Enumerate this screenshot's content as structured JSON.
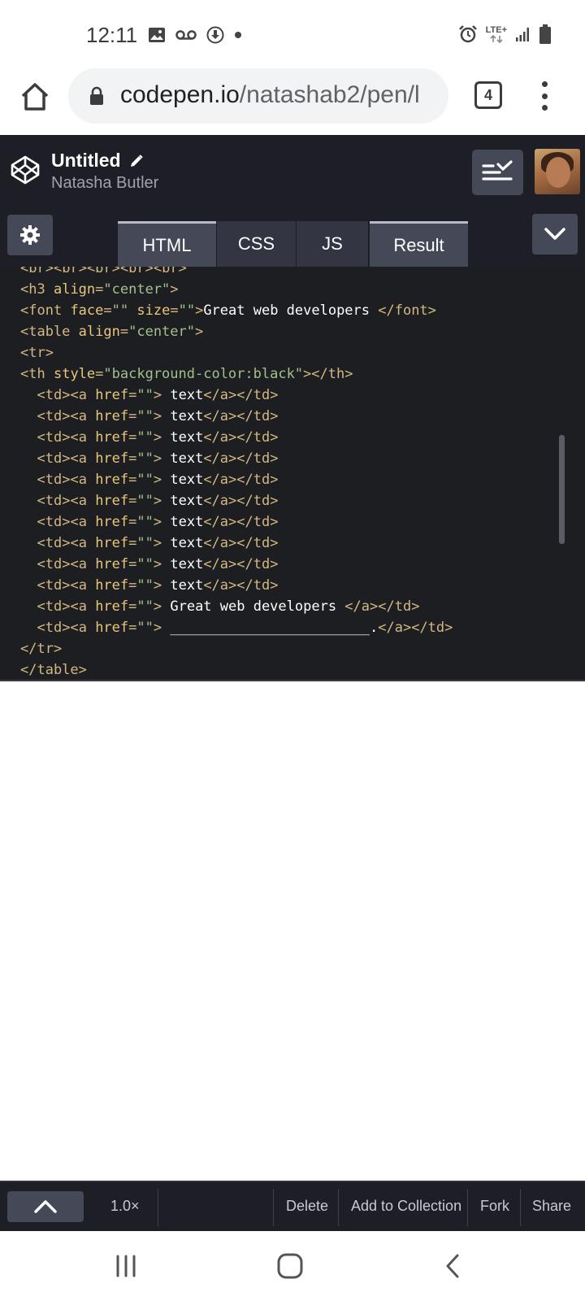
{
  "status_bar": {
    "time": "12:11",
    "network": "LTE+",
    "icons_left": [
      "image-icon",
      "voicemail-icon",
      "download-icon",
      "dot-icon"
    ],
    "icons_right": [
      "alarm-icon",
      "lte-icon",
      "signal-icon",
      "battery-icon"
    ]
  },
  "browser": {
    "url_domain": "codepen.io",
    "url_path": "/natashab2/pen/l",
    "tab_count": "4"
  },
  "codepen": {
    "title": "Untitled",
    "author": "Natasha Butler",
    "tabs": [
      {
        "label": "HTML",
        "active": true
      },
      {
        "label": "CSS",
        "active": false
      },
      {
        "label": "JS",
        "active": false
      },
      {
        "label": "Result",
        "active": true
      }
    ]
  },
  "editor": {
    "lines": [
      "<br><br><br><br><br>",
      "<h3 align=\"center\">",
      "<font face=\"\" size=\"\">Great web developers </font>",
      "<table align=\"center\">",
      "<tr>",
      "<th style=\"background-color:black\"></th>",
      "  <td><a href=\"\"> text</a></td>",
      "  <td><a href=\"\"> text</a></td>",
      "  <td><a href=\"\"> text</a></td>",
      "  <td><a href=\"\"> text</a></td>",
      "  <td><a href=\"\"> text</a></td>",
      "  <td><a href=\"\"> text</a></td>",
      "  <td><a href=\"\"> text</a></td>",
      "  <td><a href=\"\"> text</a></td>",
      "  <td><a href=\"\"> text</a></td>",
      "  <td><a href=\"\"> text</a></td>",
      "  <td><a href=\"\"> Great web developers </a></td>",
      "  <td><a href=\"\"> ________________________.</a></td>",
      "</tr>",
      "</table>"
    ]
  },
  "bottom_toolbar": {
    "zoom": "1.0×",
    "delete": "Delete",
    "add_to_collection": "Add to Collection",
    "fork": "Fork",
    "share": "Share"
  },
  "colors": {
    "header_bg": "#1e1f26",
    "editor_bg": "#1d1e22",
    "tag": "#d4b882",
    "attr": "#e8c77a",
    "string": "#a3c08b",
    "text": "#ffffff",
    "button_bg": "#444857"
  }
}
